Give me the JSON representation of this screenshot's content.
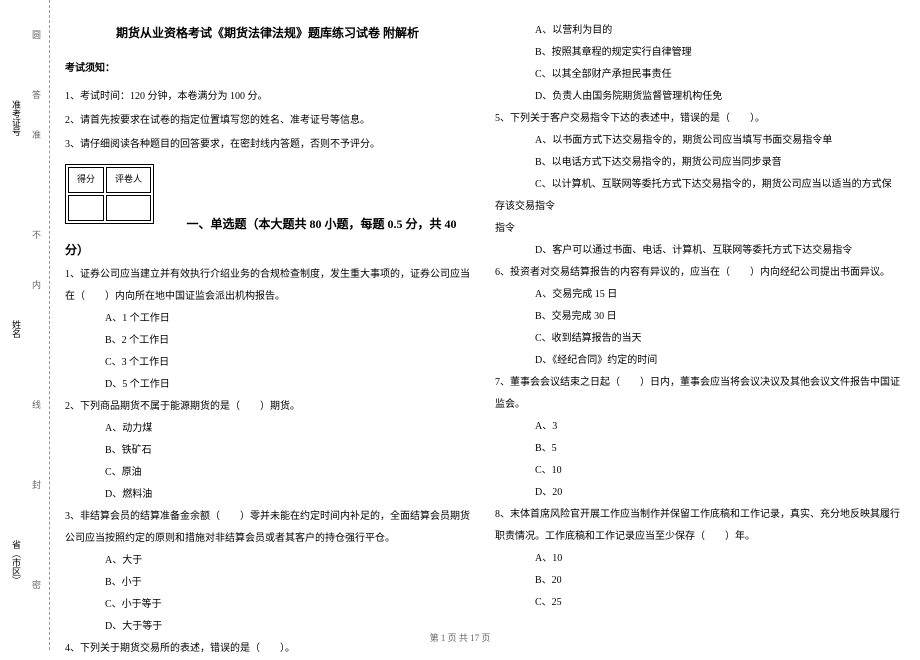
{
  "binding": {
    "marks": [
      "圆",
      "答",
      "准",
      "不",
      "内",
      "线",
      "封",
      "密"
    ],
    "labels": [
      "准考证号",
      "姓名",
      "省（市区）"
    ]
  },
  "header": {
    "title": "期货从业资格考试《期货法律法规》题库练习试卷 附解析"
  },
  "notice": {
    "heading": "考试须知：",
    "items": [
      "1、考试时间：120 分钟，本卷满分为 100 分。",
      "2、请首先按要求在试卷的指定位置填写您的姓名、准考证号等信息。",
      "3、请仔细阅读各种题目的回答要求，在密封线内答题，否则不予评分。"
    ]
  },
  "score_table": {
    "h1": "得分",
    "h2": "评卷人"
  },
  "part1": {
    "title": "一、单选题（本大题共 80 小题，每题 0.5 分，共 40 分）"
  },
  "questions_left": [
    {
      "stem": "1、证券公司应当建立并有效执行介绍业务的合规检查制度，发生重大事项的，证券公司应当在（　　）内向所在地中国证监会派出机构报告。",
      "opts": [
        "A、1 个工作日",
        "B、2 个工作日",
        "C、3 个工作日",
        "D、5 个工作日"
      ]
    },
    {
      "stem": "2、下列商品期货不属于能源期货的是（　　）期货。",
      "opts": [
        "A、动力煤",
        "B、铁矿石",
        "C、原油",
        "D、燃料油"
      ]
    },
    {
      "stem": "3、非结算会员的结算准备金余额（　　）零并未能在约定时间内补足的，全面结算会员期货公司应当按照约定的原则和措施对非结算会员或者其客户的持仓强行平仓。",
      "opts": [
        "A、大于",
        "B、小于",
        "C、小于等于",
        "D、大于等于"
      ]
    },
    {
      "stem": "4、下列关于期货交易所的表述，错误的是（　　）。",
      "opts": []
    }
  ],
  "questions_right": [
    {
      "stem": "",
      "opts": [
        "A、以营利为目的",
        "B、按照其章程的规定实行自律管理",
        "C、以其全部财产承担民事责任",
        "D、负责人由国务院期货监督管理机构任免"
      ]
    },
    {
      "stem": "5、下列关于客户交易指令下达的表述中，错误的是（　　）。",
      "opts": [
        "A、以书面方式下达交易指令的，期货公司应当填写书面交易指令单",
        "B、以电话方式下达交易指令的，期货公司应当同步录音",
        "C、以计算机、互联网等委托方式下达交易指令的，期货公司应当以适当的方式保存该交易指令",
        "D、客户可以通过书面、电话、计算机、互联网等委托方式下达交易指令"
      ]
    },
    {
      "stem": "6、投资者对交易结算报告的内容有异议的，应当在（　　）内向经纪公司提出书面异议。",
      "opts": [
        "A、交易完成 15 日",
        "B、交易完成 30 日",
        "C、收到结算报告的当天",
        "D、《经纪合同》约定的时间"
      ]
    },
    {
      "stem": "7、董事会会议结束之日起（　　）日内，董事会应当将会议决议及其他会议文件报告中国证监会。",
      "opts": [
        "A、3",
        "B、5",
        "C、10",
        "D、20"
      ]
    },
    {
      "stem": "8、末体首席风险官开展工作应当制作并保留工作底稿和工作记录，真实、充分地反映其履行职责情况。工作底稿和工作记录应当至少保存（　　）年。",
      "opts": [
        "A、10",
        "B、20",
        "C、25"
      ]
    }
  ],
  "footer": {
    "text": "第 1 页 共 17 页"
  }
}
